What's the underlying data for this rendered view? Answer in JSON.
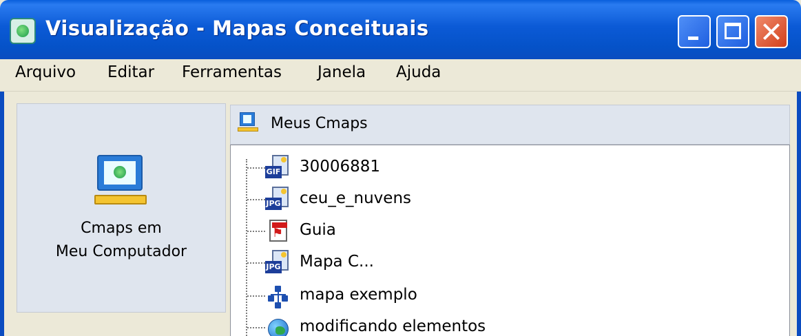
{
  "window": {
    "title": "Visualização - Mapas Conceituais",
    "app_icon": "cmap-globe-icon",
    "controls": [
      "minimize-icon",
      "maximize-icon",
      "close-icon"
    ]
  },
  "menu": {
    "items": [
      "Arquivo",
      "Editar",
      "Ferramentas",
      "Janela",
      "Ajuda"
    ]
  },
  "left_panel": {
    "icon": "computer-icon",
    "label_line1": "Cmaps em",
    "label_line2": "Meu Computador"
  },
  "right_panel": {
    "header": {
      "icon": "cmaps-folder-icon",
      "label": "Meus Cmaps"
    },
    "tree": [
      {
        "label": "30006881",
        "icon": "gif-file-icon",
        "icon_tag": "GIF"
      },
      {
        "label": "ceu_e_nuvens",
        "icon": "jpg-file-icon",
        "icon_tag": "JPG"
      },
      {
        "label": "Guia",
        "icon": "pdf-file-icon"
      },
      {
        "label": "Mapa C...",
        "icon": "jpg-file-icon",
        "icon_tag": "JPG"
      },
      {
        "label": "mapa exemplo",
        "icon": "concept-map-icon"
      },
      {
        "label": "modificando elementos",
        "icon": "web-globe-icon"
      }
    ]
  },
  "colors": {
    "titlebar": "#0b5ad6",
    "close_button": "#d2401c",
    "window_bg": "#ece9d8",
    "panel_bg": "#dfe5ee",
    "tree_bg": "#ffffff"
  }
}
